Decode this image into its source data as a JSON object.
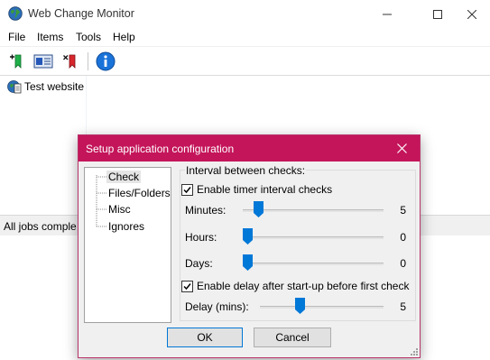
{
  "app": {
    "title": "Web Change Monitor"
  },
  "menu": [
    "File",
    "Items",
    "Tools",
    "Help"
  ],
  "toolbar": {
    "add_icon": "add-bookmark-icon",
    "view_icon": "details-view-icon",
    "remove_icon": "remove-bookmark-icon",
    "info_icon": "info-icon"
  },
  "tree": {
    "items": [
      "Test website"
    ]
  },
  "status": {
    "text": "All jobs comple"
  },
  "dialog": {
    "title": "Setup application configuration",
    "tree_nodes": [
      "Check",
      "Files/Folders",
      "Misc",
      "Ignores"
    ],
    "selected_node": "Check",
    "group_title": "Interval between checks:",
    "enable_timer_label": "Enable timer interval checks",
    "enable_timer_checked": true,
    "minutes_label": "Minutes:",
    "minutes_value": "5",
    "hours_label": "Hours:",
    "hours_value": "0",
    "days_label": "Days:",
    "days_value": "0",
    "enable_delay_label": "Enable delay after start-up before first check",
    "enable_delay_checked": true,
    "delay_label": "Delay (mins):",
    "delay_value": "5",
    "ok_label": "OK",
    "cancel_label": "Cancel"
  },
  "sliders": {
    "minutes_fraction": 0.083,
    "hours_fraction": 0.0,
    "days_fraction": 0.0,
    "delay_fraction": 0.31
  },
  "colors": {
    "dialog_title_bg": "#c4155a",
    "info_blue": "#1a73d9",
    "default_button_border": "#0078d7"
  }
}
